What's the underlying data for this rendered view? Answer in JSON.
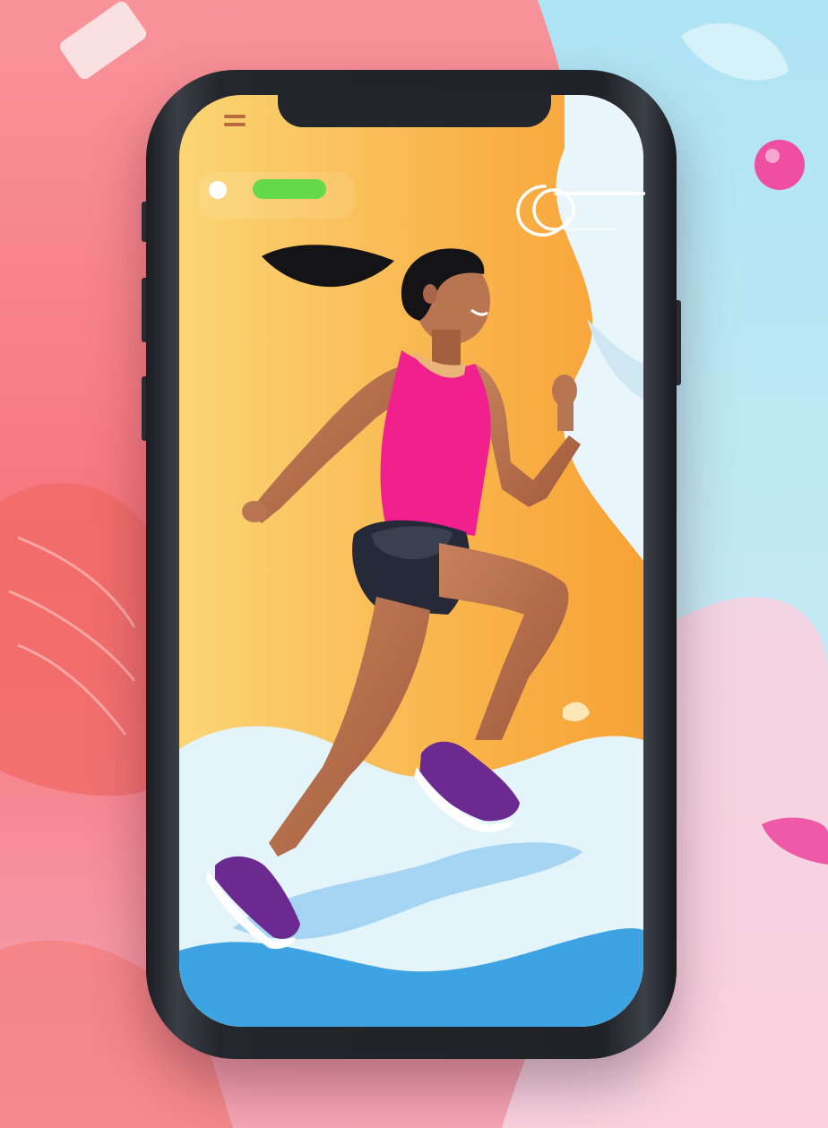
{
  "scene": {
    "subject": "woman-running",
    "icons": [
      "menu-icon",
      "status-dot-icon",
      "progress-pill-icon",
      "toggle-icon"
    ],
    "colors": {
      "background_left": "#f57f86",
      "background_right": "#a9e2f2",
      "screen_top": "#fbd574",
      "screen_orange": "#f8a33a",
      "top_shirt": "#f21f8e",
      "shorts": "#262a38",
      "shoes": "#6b2a8f",
      "water": "#3ea3e2",
      "status_green": "#64d94a"
    }
  }
}
